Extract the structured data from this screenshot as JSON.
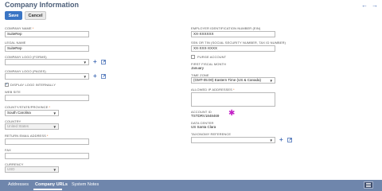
{
  "page": {
    "title": "Company Information",
    "back_arrow": "←",
    "forward_arrow": "→"
  },
  "toolbar": {
    "save_label": "Save",
    "cancel_label": "Cancel"
  },
  "left": {
    "company_name_label": "COMPANY NAME",
    "company_name_value": "SuiteRep",
    "legal_name_label": "LEGAL NAME",
    "legal_name_value": "SuiteRep",
    "logo_forms_label": "COMPANY LOGO (FORMS)",
    "logo_pages_label": "COMPANY LOGO (PAGES)",
    "display_logo_label": "DISPLAY LOGO INTERNALLY",
    "display_logo_checked": true,
    "web_site_label": "WEB SITE",
    "country_state_label": "COUNTY/STATE/PROVINCE",
    "country_state_value": "South Carolina",
    "country_label": "COUNTRY",
    "country_value": "United States",
    "return_email_label": "RETURN EMAIL ADDRESS",
    "fax_label": "FAX",
    "currency_label": "CURRENCY",
    "currency_value": "USD"
  },
  "right": {
    "ein_label": "EMPLOYER IDENTIFICATION NUMBER (EIN)",
    "ein_value": "XX-XXXXXX",
    "ssn_label": "SSN OR TIN (SOCIAL SECURITY NUMBER, TAX ID NUMBER)",
    "ssn_value": "XX-XXX-XXXX",
    "purge_label": "PURGE ACCOUNT",
    "purge_checked": false,
    "fiscal_month_label": "FIRST FISCAL MONTH",
    "fiscal_month_value": "January",
    "time_zone_label": "TIME ZONE",
    "time_zone_value": "(GMT-05:00) Eastern Time (US & Canada)",
    "allowed_ip_label": "ALLOWED IP ADDRESSES",
    "account_id_label": "ACCOUNT ID",
    "account_id_value": "TSTDRV1848469",
    "data_center_label": "DATA CENTER",
    "data_center_value": "US Santa Clara",
    "taxonomy_label": "TAXONOMY REFERENCE"
  },
  "icons": {
    "plus": "+",
    "dropdown": "▼",
    "required": "*",
    "star": "✱"
  },
  "tabs": [
    {
      "label": "Addresses",
      "active": false
    },
    {
      "label": "Company URLs",
      "active": true
    },
    {
      "label": "System Notes",
      "active": false
    }
  ],
  "colors": {
    "accent": "#3a75c4",
    "title": "#4d5f79",
    "tabbar": "#6f86ac",
    "required": "#e0661b",
    "star": "#c21ec6"
  }
}
